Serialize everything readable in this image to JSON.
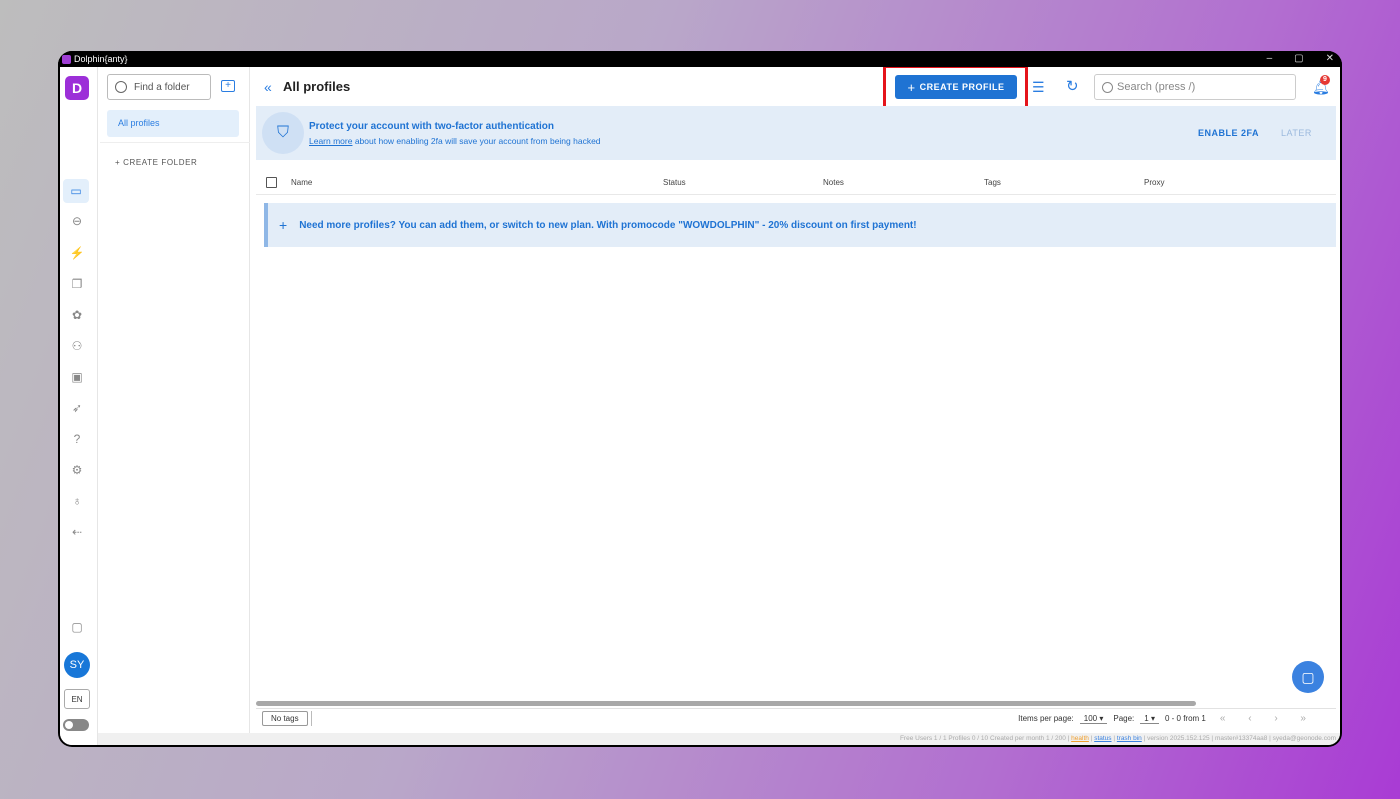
{
  "window": {
    "title": "Dolphin{anty}",
    "controls": [
      "–",
      "▢",
      "✕"
    ]
  },
  "rail": {
    "logo": "D",
    "icons": [
      "browser-profiles-icon",
      "link-icon",
      "automation-icon",
      "copy-icon",
      "extensions-icon",
      "users-icon",
      "api-icon",
      "rocket-icon",
      "help-icon",
      "settings-icon",
      "lightbulb-icon",
      "logout-icon"
    ],
    "wallet_icon": "wallet-icon",
    "avatar": "SY",
    "lang": "EN"
  },
  "folders": {
    "search_placeholder": "Find a folder",
    "active_folder": "All profiles",
    "create_folder": "+ CREATE FOLDER"
  },
  "header": {
    "collapse": "«",
    "title": "All profiles",
    "create_profile_plus": "+",
    "create_profile_label": "CREATE PROFILE",
    "search_placeholder": "Search (press /)",
    "notification_count": "9"
  },
  "banner_2fa": {
    "headline": "Protect your account with two-factor authentication",
    "learn_more": "Learn more",
    "sub_text": " about how enabling 2fa will save your account from being hacked",
    "enable_label": "ENABLE 2FA",
    "later_label": "LATER"
  },
  "table": {
    "columns": [
      "Name",
      "Status",
      "Notes",
      "Tags",
      "Proxy"
    ]
  },
  "promo": {
    "plus": "+",
    "text": "Need more profiles? You can add them, or switch to new plan. With promocode \"WOWDOLPHIN\" - 20% discount on first payment!"
  },
  "footer": {
    "no_tags": "No tags",
    "items_per_page_label": "Items per page:",
    "items_per_page_value": "100",
    "page_label": "Page:",
    "page_value": "1",
    "range": "0 - 0 from 1",
    "nav": "« ‹ › »"
  },
  "statusbar": {
    "plan": "Free",
    "users": "Users 1 / 1",
    "profiles": "Profiles 0 / 10",
    "created": "Created per month 1 / 200",
    "health": "health",
    "status": "status",
    "trash": "trash bin",
    "version": "version 2025.152.125",
    "build": "master#13374aa8",
    "email": "syeda@geonode.com"
  }
}
